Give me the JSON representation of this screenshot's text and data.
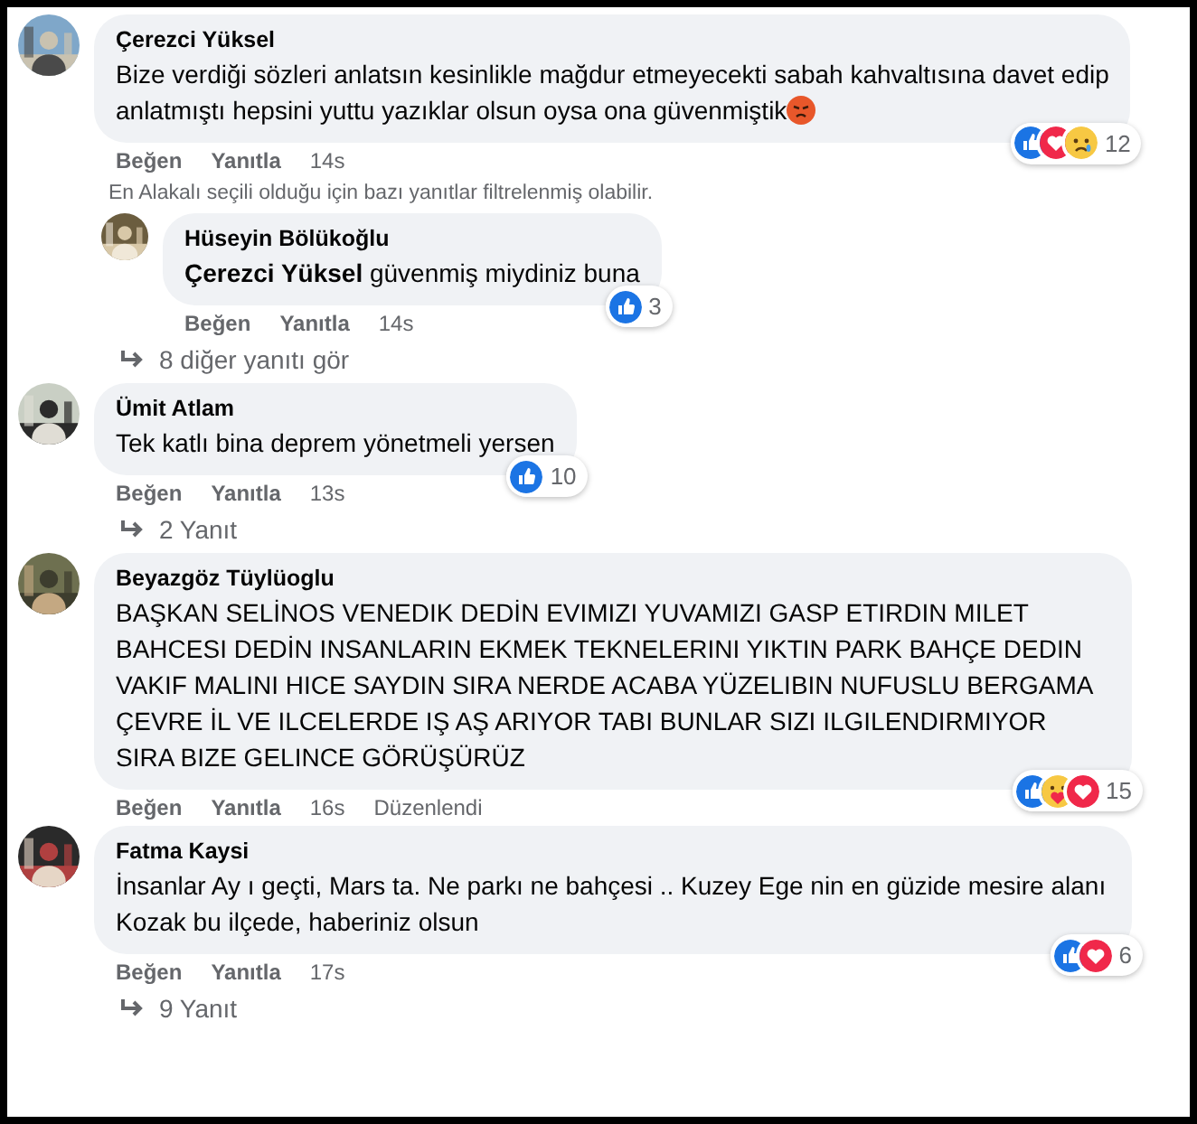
{
  "items": [
    {
      "kind": "comment",
      "author": "Çerezci Yüksel",
      "paragraphs": [
        "Bize verdiği sözleri anlatsın kesinlikle mağdur etmeyecekti sabah kahvaltısına davet edip",
        "anlatmıştı hepsini yuttu yazıklar olsun oysa ona güvenmiştik"
      ],
      "emoji": {
        "kind": "angry"
      },
      "reactions": [
        {
          "kind": "like"
        },
        {
          "kind": "love"
        },
        {
          "kind": "sad"
        }
      ],
      "reaction_count": "12",
      "like_label": "Beğen",
      "reply_label": "Yanıtla",
      "time": "14s"
    },
    {
      "kind": "notice",
      "text": "En Alakalı seçili olduğu için bazı yanıtlar filtrelenmiş olabilir."
    },
    {
      "kind": "reply",
      "author": "Hüseyin Bölükoğlu",
      "paragraphs": [
        "**Çerezci Yüksel** güvenmiş miydiniz buna"
      ],
      "reactions": [
        {
          "kind": "like"
        }
      ],
      "reaction_count": "3",
      "like_label": "Beğen",
      "reply_label": "Yanıtla",
      "time": "14s"
    },
    {
      "kind": "more",
      "text": "8 diğer yanıtı gör"
    },
    {
      "kind": "comment",
      "author": "Ümit Atlam",
      "paragraphs": [
        "Tek katlı bina deprem yönetmeli yersen"
      ],
      "reactions": [
        {
          "kind": "like"
        }
      ],
      "reaction_count": "10",
      "like_label": "Beğen",
      "reply_label": "Yanıtla",
      "time": "13s"
    },
    {
      "kind": "more",
      "text": "2 Yanıt"
    },
    {
      "kind": "comment",
      "author": "Beyazgöz Tüylüoglu",
      "paragraphs": [
        "BAŞKAN SELİNOS VENEDIK DEDİN EVIMIZI YUVAMIZI GASP ETIRDIN MILET BAHCESI DEDİN INSANLARIN EKMEK TEKNELERINI YIKTIN PARK BAHÇE DEDIN VAKIF MALINI HICE SAYDIN SIRA NERDE ACABA YÜZELIBIN NUFUSLU BERGAMA ÇEVRE İL VE ILCELERDE IŞ AŞ ARIYOR TABI BUNLAR SIZI ILGILENDIRMIYOR SIRA BIZE GELINCE GÖRÜŞÜRÜZ"
      ],
      "reactions": [
        {
          "kind": "like"
        },
        {
          "kind": "care"
        },
        {
          "kind": "love"
        }
      ],
      "reaction_count": "15",
      "like_label": "Beğen",
      "reply_label": "Yanıtla",
      "time": "16s",
      "edited": "Düzenlendi"
    },
    {
      "kind": "comment",
      "author": "Fatma Kaysi",
      "paragraphs": [
        "İnsanlar Ay ı geçti, Mars ta. Ne parkı ne bahçesi .. Kuzey Ege nin en güzide mesire alanı Kozak bu ilçede, haberiniz olsun"
      ],
      "reactions": [
        {
          "kind": "like"
        },
        {
          "kind": "love"
        }
      ],
      "reaction_count": "6",
      "like_label": "Beğen",
      "reply_label": "Yanıtla",
      "time": "17s"
    },
    {
      "kind": "more",
      "text": "9 Yanıt"
    }
  ]
}
